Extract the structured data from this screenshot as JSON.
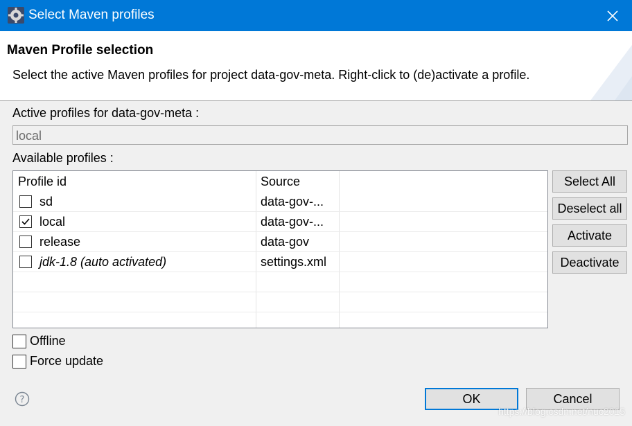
{
  "window": {
    "title": "Select Maven profiles",
    "icon": "eclipse-gear-icon"
  },
  "header": {
    "title": "Maven Profile selection",
    "description": "Select the active Maven profiles for project data-gov-meta. Right-click to (de)activate a profile."
  },
  "active": {
    "label": "Active profiles for data-gov-meta :",
    "value": "local"
  },
  "available": {
    "label": "Available profiles :",
    "columns": [
      "Profile id",
      "Source"
    ],
    "rows": [
      {
        "id": "sd",
        "source": "data-gov-...",
        "checked": false,
        "italic": false
      },
      {
        "id": "local",
        "source": "data-gov-...",
        "checked": true,
        "italic": false
      },
      {
        "id": "release",
        "source": "data-gov",
        "checked": false,
        "italic": false
      },
      {
        "id": "jdk-1.8 (auto activated)",
        "source": "settings.xml",
        "checked": false,
        "italic": true
      }
    ]
  },
  "side_buttons": {
    "select_all": "Select All",
    "deselect_all": "Deselect all",
    "activate": "Activate",
    "deactivate": "Deactivate"
  },
  "options": {
    "offline": "Offline",
    "force_update": "Force update"
  },
  "footer": {
    "ok": "OK",
    "cancel": "Cancel",
    "help_icon": "help-icon"
  },
  "watermark": "https://blog.csdn.net/nuc2015",
  "colors": {
    "titlebar": "#0078d7",
    "dialog_bg": "#f0f0f0",
    "default_button_border": "#0078d7"
  }
}
